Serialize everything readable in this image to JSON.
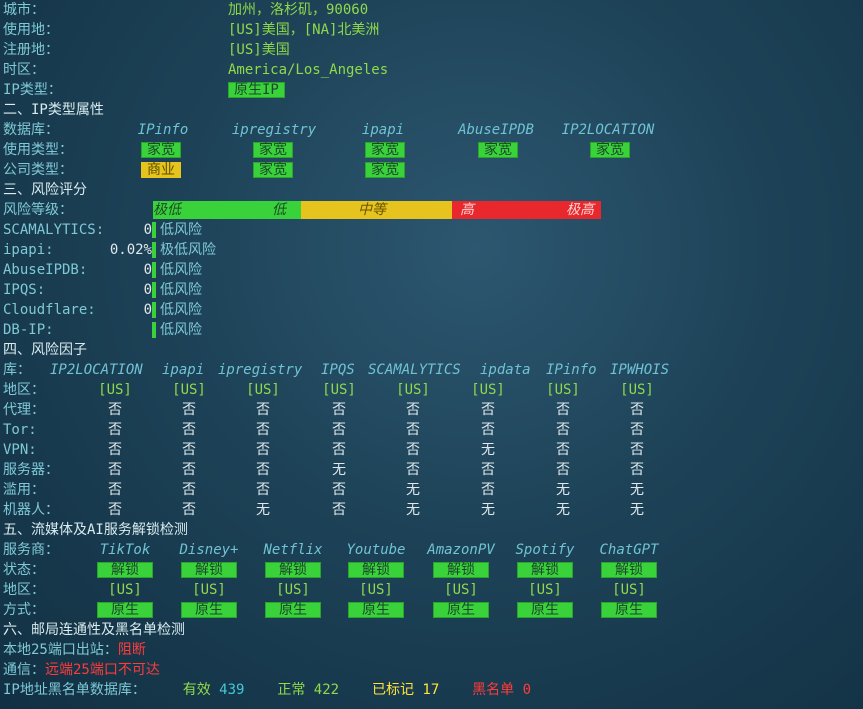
{
  "basic": {
    "city_label": "城市：",
    "city_value": "加州，洛杉矶，90060",
    "usage_loc_label": "使用地：",
    "usage_loc_value": "[US]美国，[NA]北美洲",
    "reg_loc_label": "注册地：",
    "reg_loc_value": "[US]美国",
    "tz_label": "时区：",
    "tz_value": "America/Los_Angeles",
    "iptype_label": "IP类型：",
    "iptype_value": "原生IP"
  },
  "section2": {
    "title": "二、IP类型属性",
    "db_label": "数据库：",
    "use_label": "使用类型：",
    "company_label": "公司类型：",
    "dbs": [
      "IPinfo",
      "ipregistry",
      "ipapi",
      "AbuseIPDB",
      "IP2LOCATION"
    ],
    "use_types": [
      "家宽",
      "家宽",
      "家宽",
      "家宽",
      "家宽"
    ],
    "company_types": [
      "商业",
      "家宽",
      "家宽"
    ]
  },
  "section3": {
    "title": "三、风险评分",
    "level_label": "风险等级：",
    "bar": [
      "极低",
      "低",
      "中等",
      "高",
      "极高"
    ],
    "rows": [
      {
        "name": "SCAMALYTICS:",
        "score": "0",
        "desc": "低风险"
      },
      {
        "name": "ipapi:",
        "score": "0.02%",
        "desc": "极低风险"
      },
      {
        "name": "AbuseIPDB:",
        "score": "0",
        "desc": "低风险"
      },
      {
        "name": "IPQS:",
        "score": "0",
        "desc": "低风险"
      },
      {
        "name": "Cloudflare:",
        "score": "0",
        "desc": "低风险"
      },
      {
        "name": "DB-IP:",
        "score": "",
        "desc": "低风险"
      }
    ]
  },
  "section4": {
    "title": "四、风险因子",
    "lib_label": "库：",
    "libs": [
      "IP2LOCATION",
      "ipapi",
      "ipregistry",
      "IPQS",
      "SCAMALYTICS",
      "ipdata",
      "IPinfo",
      "IPWHOIS"
    ],
    "rows": [
      {
        "label": "地区：",
        "values": [
          "[US]",
          "[US]",
          "[US]",
          "[US]",
          "[US]",
          "[US]",
          "[US]",
          "[US]"
        ]
      },
      {
        "label": "代理：",
        "values": [
          "否",
          "否",
          "否",
          "否",
          "否",
          "否",
          "否",
          "否"
        ]
      },
      {
        "label": "Tor:",
        "values": [
          "否",
          "否",
          "否",
          "否",
          "否",
          "否",
          "否",
          "否"
        ]
      },
      {
        "label": "VPN:",
        "values": [
          "否",
          "否",
          "否",
          "否",
          "否",
          "无",
          "否",
          "否"
        ]
      },
      {
        "label": "服务器：",
        "values": [
          "否",
          "否",
          "否",
          "无",
          "否",
          "否",
          "否",
          "否"
        ]
      },
      {
        "label": "滥用：",
        "values": [
          "否",
          "否",
          "否",
          "否",
          "无",
          "否",
          "无",
          "无"
        ]
      },
      {
        "label": "机器人：",
        "values": [
          "否",
          "否",
          "无",
          "否",
          "无",
          "无",
          "无",
          "无"
        ]
      }
    ]
  },
  "section5": {
    "title": "五、流媒体及AI服务解锁检测",
    "provider_label": "服务商：",
    "status_label": "状态：",
    "region_label": "地区：",
    "method_label": "方式：",
    "providers": [
      "TikTok",
      "Disney+",
      "Netflix",
      "Youtube",
      "AmazonPV",
      "Spotify",
      "ChatGPT"
    ],
    "status": [
      "解锁",
      "解锁",
      "解锁",
      "解锁",
      "解锁",
      "解锁",
      "解锁"
    ],
    "regions": [
      "[US]",
      "[US]",
      "[US]",
      "[US]",
      "[US]",
      "[US]",
      "[US]"
    ],
    "methods": [
      "原生",
      "原生",
      "原生",
      "原生",
      "原生",
      "原生",
      "原生"
    ]
  },
  "section6": {
    "title": "六、邮局连通性及黑名单检测",
    "port_label": "本地25端口出站：",
    "port_value": "阻断",
    "comm_label": "通信：",
    "comm_value": "远端25端口不可达",
    "bl_label": "IP地址黑名单数据库：",
    "valid_label": "有效",
    "valid_value": "439",
    "normal_label": "正常",
    "normal_value": "422",
    "marked_label": "已标记",
    "marked_value": "17",
    "black_label": "黑名单",
    "black_value": "0"
  },
  "colors": {
    "green": "#3ad23a",
    "yellow": "#e6c41d",
    "red": "#e8282c",
    "label": "#7ec9d6"
  }
}
